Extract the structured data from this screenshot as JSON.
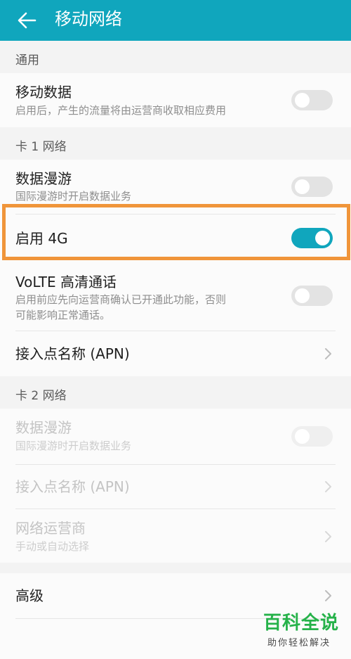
{
  "app_bar": {
    "title": "移动网络",
    "back_icon": "arrow-back-icon"
  },
  "sections": {
    "general": "通用",
    "sim1": "卡 1 网络",
    "sim2": "卡 2 网络"
  },
  "items": {
    "mobile_data": {
      "title": "移动数据",
      "subtitle": "启用后，产生的流量将由运营商收取相应费用",
      "enabled": false
    },
    "sim1_roaming": {
      "title": "数据漫游",
      "subtitle": "国际漫游时开启数据业务",
      "enabled": false
    },
    "enable_4g": {
      "title": "启用 4G",
      "enabled": true
    },
    "volte": {
      "title": "VoLTE 高清通话",
      "subtitle_line1": "启用前应先向运营商确认已开通此功能，否则",
      "subtitle_line2": "可能影响正常通话。",
      "enabled": false
    },
    "sim1_apn": {
      "title": "接入点名称 (APN)"
    },
    "sim2_roaming": {
      "title": "数据漫游",
      "subtitle": "国际漫游时开启数据业务",
      "enabled": false,
      "disabled": true
    },
    "sim2_apn": {
      "title": "接入点名称 (APN)",
      "disabled": true
    },
    "sim2_operator": {
      "title": "网络运营商",
      "subtitle": "手动或自动选择",
      "disabled": true
    },
    "advanced": {
      "title": "高级"
    }
  },
  "watermark": {
    "title": "百科全说",
    "subtitle": "助你轻松解决"
  },
  "colors": {
    "accent": "#10a6bd",
    "highlight": "#f0953a",
    "watermark": "#26b24a"
  }
}
